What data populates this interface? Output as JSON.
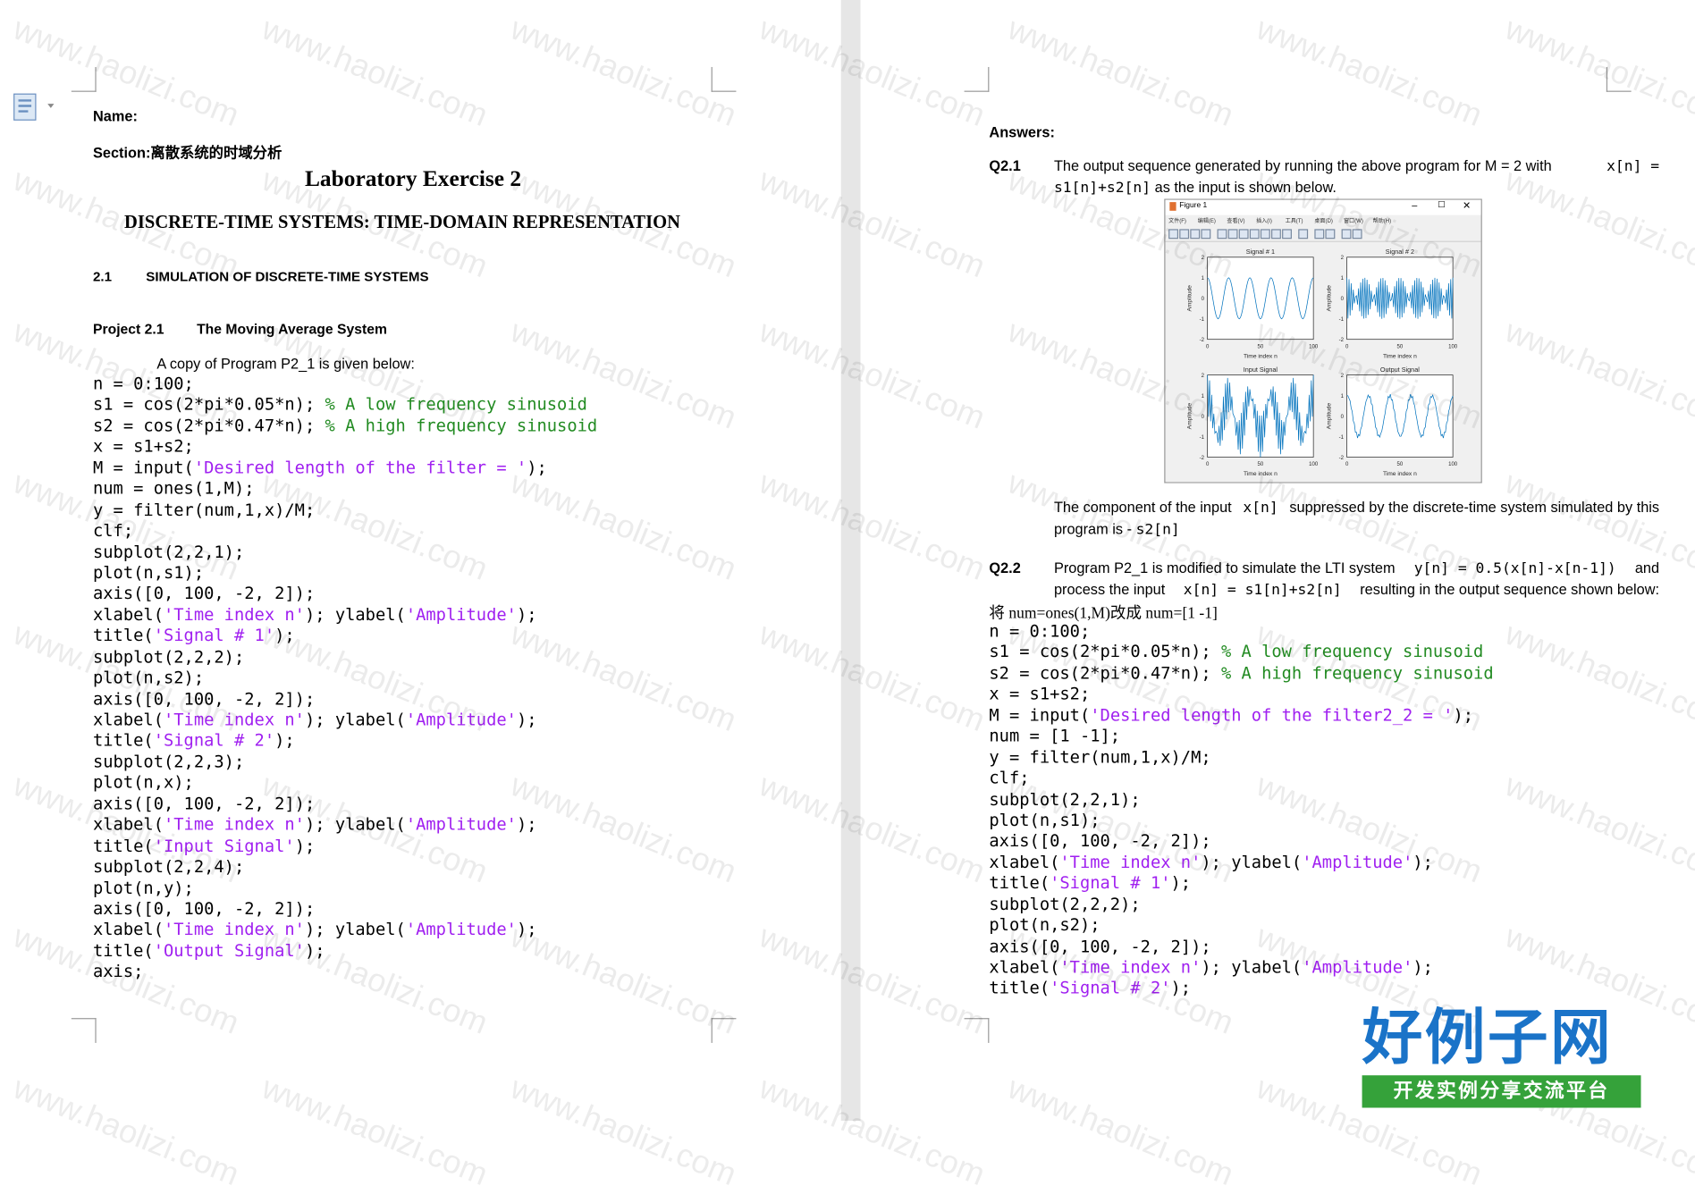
{
  "left_page": {
    "name_label": "Name:",
    "section_label": "Section:离散系统的时域分析",
    "title": "Laboratory Exercise 2",
    "subtitle": "DISCRETE-TIME SYSTEMS: TIME-DOMAIN REPRESENTATION",
    "section_number": "2.1",
    "section_title": "SIMULATION OF DISCRETE-TIME SYSTEMS",
    "project_number": "Project 2.1",
    "project_title": "The Moving Average System",
    "intro": "A copy of Program P2_1 is given below:",
    "code": [
      [
        {
          "t": "n = 0:100;"
        }
      ],
      [
        {
          "t": "s1 = cos(2*pi*0.05*n); "
        },
        {
          "t": "% A low frequency sinusoid",
          "c": "cmt"
        }
      ],
      [
        {
          "t": "s2 = cos(2*pi*0.47*n); "
        },
        {
          "t": "% A high frequency sinusoid",
          "c": "cmt"
        }
      ],
      [
        {
          "t": "x = s1+s2;"
        }
      ],
      [
        {
          "t": "M = input("
        },
        {
          "t": "'Desired length of the filter = '",
          "c": "str"
        },
        {
          "t": ");"
        }
      ],
      [
        {
          "t": "num = ones(1,M);"
        }
      ],
      [
        {
          "t": "y = filter(num,1,x)/M;"
        }
      ],
      [
        {
          "t": "clf;"
        }
      ],
      [
        {
          "t": "subplot(2,2,1);"
        }
      ],
      [
        {
          "t": "plot(n,s1);"
        }
      ],
      [
        {
          "t": "axis([0, 100, -2, 2]);"
        }
      ],
      [
        {
          "t": "xlabel("
        },
        {
          "t": "'Time index n'",
          "c": "str"
        },
        {
          "t": "); ylabel("
        },
        {
          "t": "'Amplitude'",
          "c": "str"
        },
        {
          "t": ");"
        }
      ],
      [
        {
          "t": "title("
        },
        {
          "t": "'Signal # 1'",
          "c": "str"
        },
        {
          "t": ");"
        }
      ],
      [
        {
          "t": "subplot(2,2,2);"
        }
      ],
      [
        {
          "t": "plot(n,s2);"
        }
      ],
      [
        {
          "t": "axis([0, 100, -2, 2]);"
        }
      ],
      [
        {
          "t": "xlabel("
        },
        {
          "t": "'Time index n'",
          "c": "str"
        },
        {
          "t": "); ylabel("
        },
        {
          "t": "'Amplitude'",
          "c": "str"
        },
        {
          "t": ");"
        }
      ],
      [
        {
          "t": "title("
        },
        {
          "t": "'Signal # 2'",
          "c": "str"
        },
        {
          "t": ");"
        }
      ],
      [
        {
          "t": "subplot(2,2,3);"
        }
      ],
      [
        {
          "t": "plot(n,x);"
        }
      ],
      [
        {
          "t": "axis([0, 100, -2, 2]);"
        }
      ],
      [
        {
          "t": "xlabel("
        },
        {
          "t": "'Time index n'",
          "c": "str"
        },
        {
          "t": "); ylabel("
        },
        {
          "t": "'Amplitude'",
          "c": "str"
        },
        {
          "t": ");"
        }
      ],
      [
        {
          "t": "title("
        },
        {
          "t": "'Input Signal'",
          "c": "str"
        },
        {
          "t": ");"
        }
      ],
      [
        {
          "t": "subplot(2,2,4);"
        }
      ],
      [
        {
          "t": "plot(n,y);"
        }
      ],
      [
        {
          "t": "axis([0, 100, -2, 2]);"
        }
      ],
      [
        {
          "t": "xlabel("
        },
        {
          "t": "'Time index n'",
          "c": "str"
        },
        {
          "t": "); ylabel("
        },
        {
          "t": "'Amplitude'",
          "c": "str"
        },
        {
          "t": ");"
        }
      ],
      [
        {
          "t": "title("
        },
        {
          "t": "'Output Signal'",
          "c": "str"
        },
        {
          "t": ");"
        }
      ],
      [
        {
          "t": "axis;"
        }
      ]
    ]
  },
  "right_page": {
    "answers_label": "Answers:",
    "q21": {
      "label": "Q2.1",
      "line1_text": "The output sequence generated by running the above program for M = 2 with",
      "line1_code": "x[n] =",
      "line2_code": "s1[n]+s2[n]",
      "line2_text": "as the input is shown below.",
      "after_line1": "The component of the input",
      "after_code": "x[n]",
      "after_line1b": "suppressed by the discrete-time system simulated by this",
      "after_line2": "program is -",
      "after_line2_code": "s2[n]"
    },
    "q22": {
      "label": "Q2.2",
      "line1_text": "Program P2_1 is modified to simulate the LTI system",
      "line1_code": "y[n] = 0.5(x[n]-x[n-1])",
      "line1_end": "and",
      "line2_text": "process the input",
      "line2_code": "x[n] = s1[n]+s2[n]",
      "line2_end": "resulting in the output sequence shown below:",
      "note": "将 num=ones(1,M)改成 num=[1 -1]"
    },
    "code": [
      [
        {
          "t": "n = 0:100;"
        }
      ],
      [
        {
          "t": "s1 = cos(2*pi*0.05*n); "
        },
        {
          "t": "% A low frequency sinusoid",
          "c": "cmt"
        }
      ],
      [
        {
          "t": "s2 = cos(2*pi*0.47*n); "
        },
        {
          "t": "% A high frequency sinusoid",
          "c": "cmt"
        }
      ],
      [
        {
          "t": "x = s1+s2;"
        }
      ],
      [
        {
          "t": "M = input("
        },
        {
          "t": "'Desired length of the filter2_2 = '",
          "c": "str"
        },
        {
          "t": ");"
        }
      ],
      [
        {
          "t": "num = [1 -1];"
        }
      ],
      [
        {
          "t": "y = filter(num,1,x)/M;"
        }
      ],
      [
        {
          "t": "clf;"
        }
      ],
      [
        {
          "t": "subplot(2,2,1);"
        }
      ],
      [
        {
          "t": "plot(n,s1);"
        }
      ],
      [
        {
          "t": "axis([0, 100, -2, 2]);"
        }
      ],
      [
        {
          "t": "xlabel("
        },
        {
          "t": "'Time index n'",
          "c": "str"
        },
        {
          "t": "); ylabel("
        },
        {
          "t": "'Amplitude'",
          "c": "str"
        },
        {
          "t": ");"
        }
      ],
      [
        {
          "t": "title("
        },
        {
          "t": "'Signal # 1'",
          "c": "str"
        },
        {
          "t": ");"
        }
      ],
      [
        {
          "t": "subplot(2,2,2);"
        }
      ],
      [
        {
          "t": "plot(n,s2);"
        }
      ],
      [
        {
          "t": "axis([0, 100, -2, 2]);"
        }
      ],
      [
        {
          "t": "xlabel("
        },
        {
          "t": "'Time index n'",
          "c": "str"
        },
        {
          "t": "); ylabel("
        },
        {
          "t": "'Amplitude'",
          "c": "str"
        },
        {
          "t": ");"
        }
      ],
      [
        {
          "t": "title("
        },
        {
          "t": "'Signal # 2'",
          "c": "str"
        },
        {
          "t": ");"
        }
      ]
    ],
    "figure": {
      "window_title": "Figure 1",
      "menu": [
        "文件(F)",
        "编辑(E)",
        "查看(V)",
        "插入(I)",
        "工具(T)",
        "桌面(D)",
        "窗口(W)",
        "帮助(H)"
      ],
      "subplots": [
        {
          "title": "Signal # 1",
          "xlabel": "Time index n",
          "ylabel": "Amplitude",
          "kind": "s1"
        },
        {
          "title": "Signal # 2",
          "xlabel": "Time index n",
          "ylabel": "Amplitude",
          "kind": "s2"
        },
        {
          "title": "Input Signal",
          "xlabel": "Time index n",
          "ylabel": "Amplitude",
          "kind": "x"
        },
        {
          "title": "Output Signal",
          "xlabel": "Time index n",
          "ylabel": "Amplitude",
          "kind": "y"
        }
      ],
      "xlim": [
        0,
        100
      ],
      "ylim": [
        -2,
        2
      ],
      "xticks": [
        "0",
        "50",
        "100"
      ],
      "yticks": [
        "2",
        "1",
        "0",
        "-1",
        "-2"
      ],
      "line_color": "#0072bd"
    }
  },
  "watermark": "www.haolizi.com",
  "logo": {
    "main": "好例子网",
    "sub": "开发实例分享交流平台"
  }
}
